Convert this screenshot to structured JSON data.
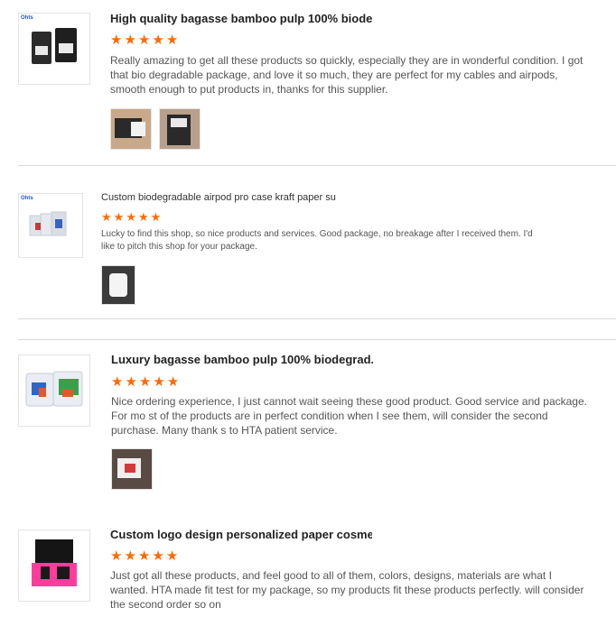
{
  "reviews": [
    {
      "title": "High quality bagasse bamboo pulp 100% biode...",
      "rating": 5,
      "star_glyph": "★",
      "thumb_brand": "Ohts",
      "icon": "product-thumbnail-black-boxes",
      "text": "Really amazing to get all these products so quickly, especially they are in wonderful condition. I got that bio degradable package, and love it so much, they are perfect for my cables and airpods, smooth enough to put products in, thanks for this supplier.",
      "photo_count": 2
    },
    {
      "title": "Custom biodegradable airpod pro case kraft paper su...",
      "rating": 5,
      "star_glyph": "★",
      "thumb_brand": "Ohts",
      "icon": "product-thumbnail-clear-boxes",
      "text": "Lucky to find this shop, so nice products and services. Good package, no breakage after I received them. I'd like to pitch this shop for your package.",
      "photo_count": 1
    },
    {
      "title": "Luxury bagasse bamboo pulp 100% biodegrad...",
      "rating": 5,
      "star_glyph": "★",
      "icon": "product-thumbnail-colorful-boxes",
      "text": "Nice ordering experience, I just cannot wait seeing these good product. Good service and package. For mo st of the products are in perfect condition when I see them, will consider the second purchase. Many thank s to HTA patient service.",
      "photo_count": 1
    },
    {
      "title": "Custom logo design personalized paper cosme...",
      "rating": 5,
      "star_glyph": "★",
      "icon": "product-thumbnail-pink-box",
      "text": "Just got all these products, and feel good to all of them, colors, designs, materials are what I wanted. HTA made fit test for my package, so my products fit these products perfectly. will consider the second order so on",
      "photo_count": 0
    }
  ],
  "colors": {
    "star": "#ff6a00",
    "divider": "#d9d9d9"
  }
}
